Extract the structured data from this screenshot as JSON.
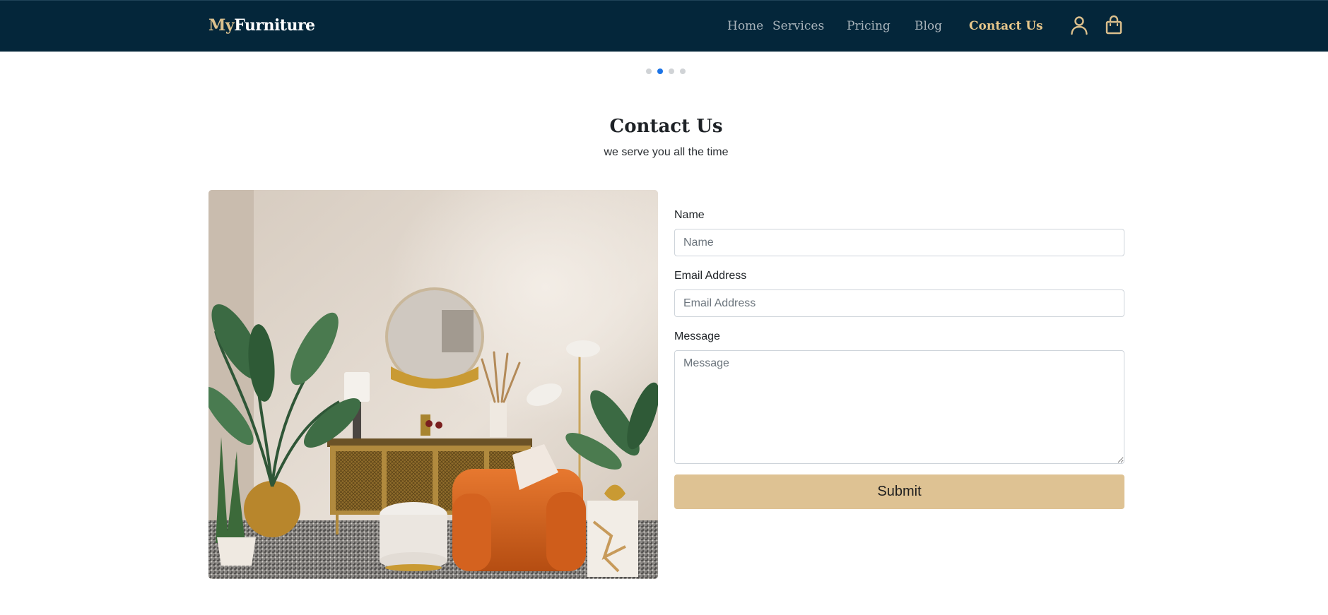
{
  "brand": {
    "prefix": "My",
    "name": "Furniture"
  },
  "nav": {
    "links": [
      {
        "label": "Home"
      },
      {
        "label": "Services"
      },
      {
        "label": "Pricing"
      },
      {
        "label": "Blog"
      },
      {
        "label": "Contact Us",
        "active": true
      }
    ],
    "icons": [
      "user-icon",
      "shopping-bag-icon"
    ]
  },
  "carousel": {
    "total": 4,
    "active": 2
  },
  "contact": {
    "title": "Contact Us",
    "subtitle": "we serve you all the time"
  },
  "form": {
    "name": {
      "label": "Name",
      "placeholder": "Name",
      "value": ""
    },
    "email": {
      "label": "Email Address",
      "placeholder": "Email Address",
      "value": ""
    },
    "message": {
      "label": "Message",
      "placeholder": "Message",
      "value": ""
    },
    "submit_label": "Submit"
  },
  "colors": {
    "navbar": "#04263a",
    "accent": "#dcc08d",
    "active_link": "#e6c68a",
    "submit": "#dec293",
    "dot_active": "#1c74e6"
  }
}
